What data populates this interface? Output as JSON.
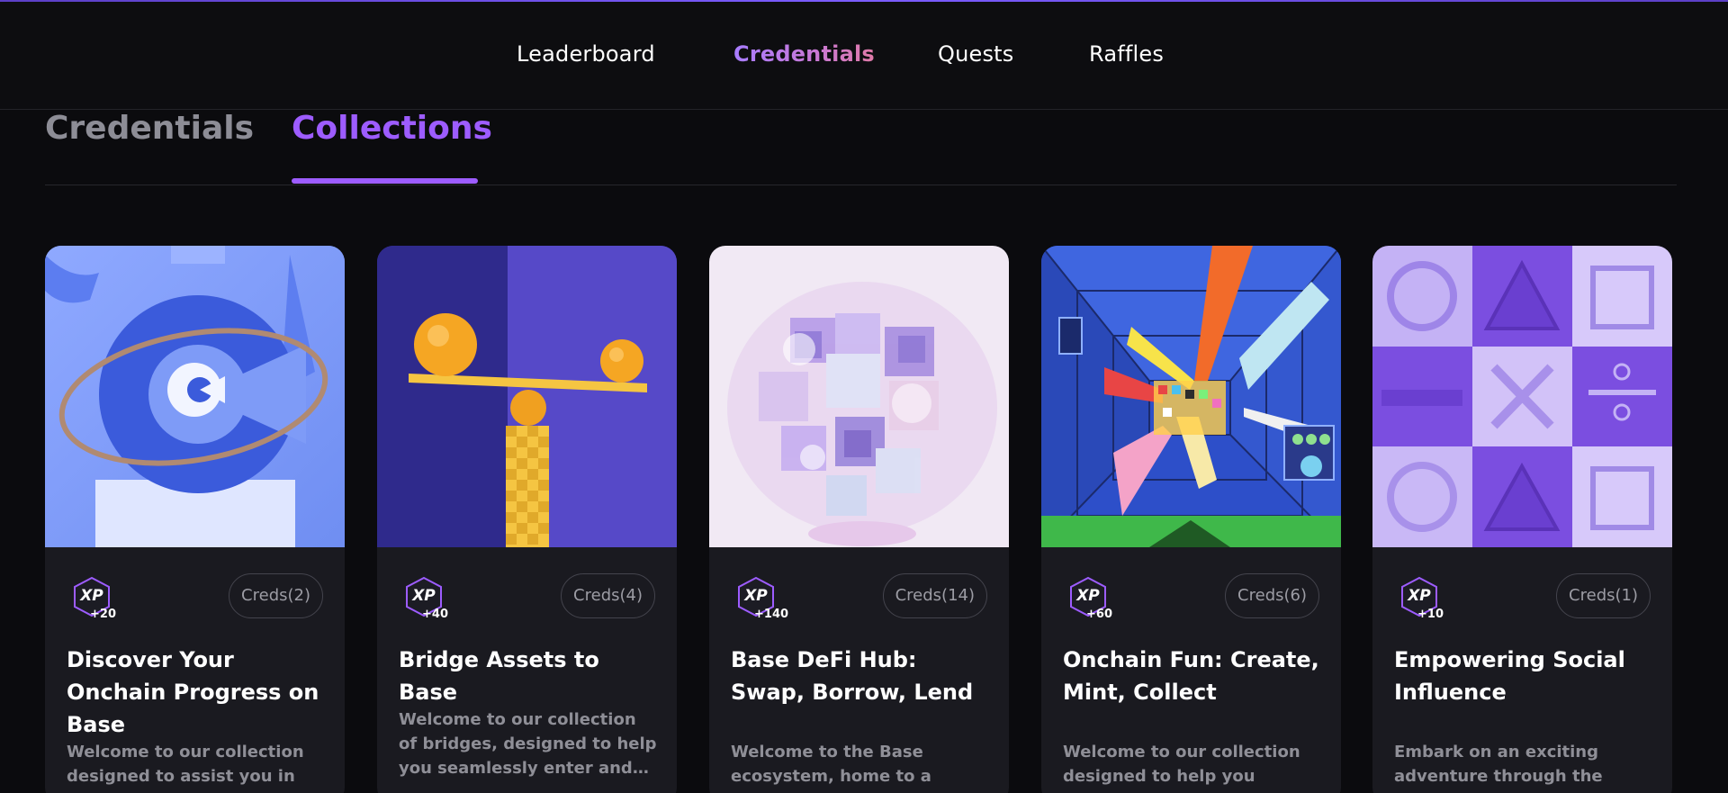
{
  "top_nav": {
    "items": [
      {
        "label": "Leaderboard",
        "active": false
      },
      {
        "label": "Credentials",
        "active": true
      },
      {
        "label": "Quests",
        "active": false
      },
      {
        "label": "Raffles",
        "active": false
      }
    ]
  },
  "sub_tabs": {
    "items": [
      {
        "label": "Credentials",
        "active": false
      },
      {
        "label": "Collections",
        "active": true
      }
    ]
  },
  "colors": {
    "accent": "#9d5cff",
    "background": "#0b0b0e",
    "card_background": "#1a1a20"
  },
  "cards": [
    {
      "xp_label": "XP",
      "xp_amount": "+20",
      "creds": "Creds(2)",
      "title": "Discover Your Onchain Progress on Base",
      "description": "Welcome to our collection designed to assist you in discovering and monitoring your onchain progress.",
      "image_icon": "ring-c-logo-image"
    },
    {
      "xp_label": "XP",
      "xp_amount": "+40",
      "creds": "Creds(4)",
      "title": "Bridge Assets to Base",
      "description": "Welcome to our collection of bridges, designed to help you seamlessly enter and exit the Base ecosystem.",
      "image_icon": "balance-scale-image"
    },
    {
      "xp_label": "XP",
      "xp_amount": "+140",
      "creds": "Creds(14)",
      "title": "Base DeFi Hub: Swap, Borrow, Lend",
      "description": "Welcome to the Base ecosystem, home to a diverse range of DeFi projects. Within this collection you will find",
      "image_icon": "glass-cubes-image"
    },
    {
      "xp_label": "XP",
      "xp_amount": "+60",
      "creds": "Creds(6)",
      "title": "Onchain Fun: Create, Mint, Collect",
      "description": "Welcome to our collection designed to help you explore the most popular NFT minting platforms on Base.",
      "image_icon": "arcade-tunnel-image"
    },
    {
      "xp_label": "XP",
      "xp_amount": "+10",
      "creds": "Creds(1)",
      "title": "Empowering Social Influence",
      "description": "Embark on an exciting adventure through the social projects within the Base ecosystem.",
      "image_icon": "shape-tiles-image"
    }
  ]
}
